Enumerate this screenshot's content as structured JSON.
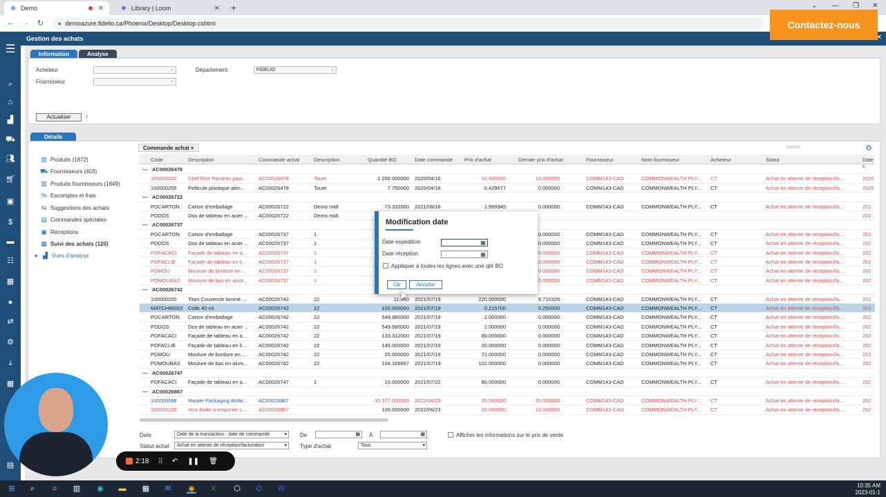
{
  "browser": {
    "tabs": [
      {
        "label": "Demo",
        "active": true
      },
      {
        "label": "Library | Loom",
        "active": false
      }
    ],
    "url": "demoazure.fidelio.ca/Phoenix/Desktop/Desktop.cshtml",
    "cta_label": "Contactez-nous"
  },
  "app": {
    "title": "Gestion des achats",
    "panel_tabs": [
      "Information",
      "Analyse"
    ],
    "fields": {
      "acheteur_label": "Acheteur",
      "fournisseur_label": "Fournisseur",
      "departement_label": "Département",
      "departement_value": "FIDELIO"
    },
    "actualiser_label": "Actualiser",
    "details_tab": "Détails",
    "tree": [
      {
        "label": "Produits (1872)",
        "bold": false
      },
      {
        "label": "Fournisseurs (403)",
        "bold": false
      },
      {
        "label": "Produits fournisseurs (1849)",
        "bold": false
      },
      {
        "label": "Escomptes et frais",
        "bold": false
      },
      {
        "label": "Suggestions des achats",
        "bold": false
      },
      {
        "label": "Commandes spéciales",
        "bold": false
      },
      {
        "label": "Réceptions",
        "bold": false
      },
      {
        "label": "Suivi des achats (120)",
        "bold": true
      },
      {
        "label": "Vues d'analyse",
        "bold": false
      }
    ],
    "grid": {
      "subtab": "Commande achat",
      "search_placeholder": "comm",
      "headers": [
        "Code",
        "Description",
        "Commande achat",
        "Description",
        "Quantité BO",
        "Date commande",
        "Prix d'achat",
        "Dernier prix d'achat",
        "Fournisseur",
        "Nom fournisseur",
        "Acheteur",
        "Statut",
        "Date c"
      ],
      "rows": [
        {
          "group": "AC00026478"
        },
        {
          "cells": [
            "100000202",
            "Chef Elite Rouleau papi...",
            "AC00026478",
            "Touet",
            "1 200.000000",
            "2020/04/16",
            "10.400000",
            "18.000000",
            "COMM143-CAD",
            "COMMONWEALTH PLY...",
            "CT",
            "Achat en attente de réception/fa...",
            "2020"
          ],
          "color": "red"
        },
        {
          "cells": [
            "100000255",
            "Pellicule plastique alim...",
            "AC00026478",
            "Touet",
            "7.750000",
            "2020/04/16",
            "6.429677",
            "0.000000",
            "COMM143-CAD",
            "COMMONWEALTH PLY...",
            "CT",
            "Achat en attente de réception/fa...",
            "2020"
          ]
        },
        {
          "group": "AC00026722"
        },
        {
          "cells": [
            "PDCARTON",
            "Carton d'emballage",
            "AC00026722",
            "Demo midi",
            "73.332000",
            "2021/06/18",
            "1.999945",
            "0.000000",
            "COMM143-CAD",
            "COMMONWEALTH PLY...",
            "CT",
            "Achat en attente de réception/fa...",
            "202"
          ]
        },
        {
          "cells": [
            "PDDOS",
            "Dos de tableau en acier ...",
            "AC00026722",
            "Demo midi",
            "",
            "",
            "",
            "",
            "",
            "",
            "",
            "",
            "202"
          ]
        },
        {
          "group": "AC00026737"
        },
        {
          "cells": [
            "PDCARTON",
            "Carton d'emballage",
            "AC00026737",
            "1",
            "",
            "",
            "",
            "0.000000",
            "COMM143-CAD",
            "COMMONWEALTH PLY...",
            "CT",
            "Achat en attente de réception/fa...",
            "202"
          ]
        },
        {
          "cells": [
            "PDDOS",
            "Dos de tableau en acier ...",
            "AC00026737",
            "1",
            "",
            "",
            "",
            "0.000000",
            "COMM143-CAD",
            "COMMONWEALTH PLY...",
            "CT",
            "Achat en attente de réception/fa...",
            "202"
          ]
        },
        {
          "cells": [
            "PDFACACI",
            "Façade de tableau en a...",
            "AC00026737",
            "1",
            "",
            "",
            "",
            "0.000000",
            "COMM143-CAD",
            "COMMONWEALTH PLY...",
            "CT",
            "Achat en attente de réception/fa...",
            "202"
          ],
          "color": "red"
        },
        {
          "cells": [
            "PDFACLIE",
            "Façade de tableau en li...",
            "AC00026737",
            "1",
            "",
            "",
            "",
            "0.000000",
            "COMM143-CAD",
            "COMMONWEALTH PLY...",
            "CT",
            "Achat en attente de réception/fa...",
            "202"
          ],
          "color": "red"
        },
        {
          "cells": [
            "PDMOU",
            "Moulure de bordure en ...",
            "AC00026737",
            "1",
            "",
            "",
            "",
            "0.000000",
            "COMM143-CAD",
            "COMMONWEALTH PLY...",
            "CT",
            "Achat en attente de réception/fa...",
            "202"
          ],
          "color": "red"
        },
        {
          "cells": [
            "PDMOUBAS",
            "Moulure de bas en alum...",
            "AC00026737",
            "1",
            "",
            "",
            "",
            "0.000000",
            "COMM143-CAD",
            "COMMONWEALTH PLY...",
            "CT",
            "Achat en attente de réception/fa...",
            "202"
          ],
          "color": "red"
        },
        {
          "group": "AC00026742"
        },
        {
          "cells": [
            "100000200",
            "Titan Couvercle laminé ...",
            "AC00026742",
            "22",
            "11.960",
            "2021/07/19",
            "220.000000",
            "9.710328",
            "COMM143-CAD",
            "COMMONWEALTH PLY...",
            "CT",
            "Achat en attente de réception/fa...",
            "202"
          ]
        },
        {
          "cells": [
            "MATCH66002",
            "Colle 40 ml",
            "AC00026742",
            "22",
            "100.000000",
            "2021/07/19",
            "0.215700",
            "0.250000",
            "COMM143-CAD",
            "COMMONWEALTH PLY...",
            "CT",
            "Achat en attente de réception/fa...",
            "202"
          ],
          "highlight": true
        },
        {
          "cells": [
            "PDCARTON",
            "Carton d'emballage",
            "AC00026742",
            "22",
            "549.980000",
            "2021/07/19",
            "2.000000",
            "0.000000",
            "COMM143-CAD",
            "COMMONWEALTH PLY...",
            "CT",
            "Achat en attente de réception/fa...",
            "202"
          ]
        },
        {
          "cells": [
            "PDDOS",
            "Dos de tableau en acier ...",
            "AC00026742",
            "22",
            "549.980000",
            "2021/07/19",
            "2.000000",
            "0.000000",
            "COMM143-CAD",
            "COMMONWEALTH PLY...",
            "CT",
            "Achat en attente de réception/fa...",
            "202"
          ]
        },
        {
          "cells": [
            "PDFACACI",
            "Façade de tableau en a...",
            "AC00026742",
            "22",
            "133.312000",
            "2021/07/19",
            "80.000000",
            "0.000000",
            "COMM143-CAD",
            "COMMONWEALTH PLY...",
            "CT",
            "Achat en attente de réception/fa...",
            "202"
          ]
        },
        {
          "cells": [
            "PDFACLIE",
            "Façade de tableau en li...",
            "AC00026742",
            "22",
            "145.000000",
            "2021/07/19",
            "20.000000",
            "0.000000",
            "COMM143-CAD",
            "COMMONWEALTH PLY...",
            "CT",
            "Achat en attente de réception/fa...",
            "202"
          ]
        },
        {
          "cells": [
            "PDMOU",
            "Moulure de bordure en ...",
            "AC00026742",
            "22",
            "25.000000",
            "2021/07/19",
            "72.000000",
            "0.000000",
            "COMM143-CAD",
            "COMMONWEALTH PLY...",
            "CT",
            "Achat en attente de réception/fa...",
            "202"
          ]
        },
        {
          "cells": [
            "PDMOUBAS",
            "Moulure de bas en alum...",
            "AC00026742",
            "22",
            "104.166667",
            "2021/07/19",
            "102.000000",
            "0.000000",
            "COMM143-CAD",
            "COMMONWEALTH PLY...",
            "CT",
            "Achat en attente de réception/fa...",
            "202"
          ]
        },
        {
          "group": "AC00026747"
        },
        {
          "cells": [
            "PDFACACI",
            "Façade de tableau en a...",
            "AC00026747",
            "1",
            "10.000000",
            "2021/07/22",
            "80.000000",
            "0.000000",
            "COMM143-CAD",
            "COMMONWEALTH PLY...",
            "CT",
            "Achat en attente de réception/fa...",
            "202"
          ]
        },
        {
          "group": "AC00026867"
        },
        {
          "cells": [
            "100000098",
            "Master Packaging Boîte...",
            "AC00026867",
            "",
            "10 377.000000",
            "2022/06/23",
            "35.000000",
            "35.000000",
            "COMM143-CAD",
            "COMMONWEALTH PLY...",
            "CT",
            "Achat en attente de réception/fa...",
            "202"
          ],
          "color": "blue"
        },
        {
          "cells": [
            "100000100",
            "Ieco Boîte à emporter c...",
            "AC00026867",
            "",
            "100.000000",
            "2022/06/23",
            "19.040000",
            "19.040000",
            "COMM143-CAD",
            "COMMONWEALTH PLY...",
            "CT",
            "Achat en attente de réception/fa...",
            "202"
          ],
          "color": "red"
        }
      ]
    },
    "bottom": {
      "date_label": "Date",
      "date_select": "Date de la transaction - date de commande",
      "de_label": "De",
      "a_label": "À",
      "afficher_label": "Afficher les informations sur le prix de vente",
      "statut_label": "Statut achat",
      "statut_select": "Achat en attente de réception/facturation",
      "type_label": "Type d'achat",
      "type_select": "Tous"
    }
  },
  "modal": {
    "title": "Modification date",
    "expedition_label": "Date expédition",
    "reception_label": "Date réception",
    "apply_label": "Appliquer à toutes les lignes avec une qté BO",
    "ok_label": "Ok",
    "cancel_label": "Annuler"
  },
  "loom": {
    "timer": "2:18"
  },
  "taskbar": {
    "time": "10:35 AM",
    "date": "2023-01-1"
  },
  "colors": {
    "app_blue": "#1f4e79",
    "accent_blue": "#2e75b6",
    "cta_orange": "#f7941d",
    "row_red": "#d9534f",
    "row_blue": "#2a5db0",
    "highlight_row": "#b8d4e8"
  }
}
